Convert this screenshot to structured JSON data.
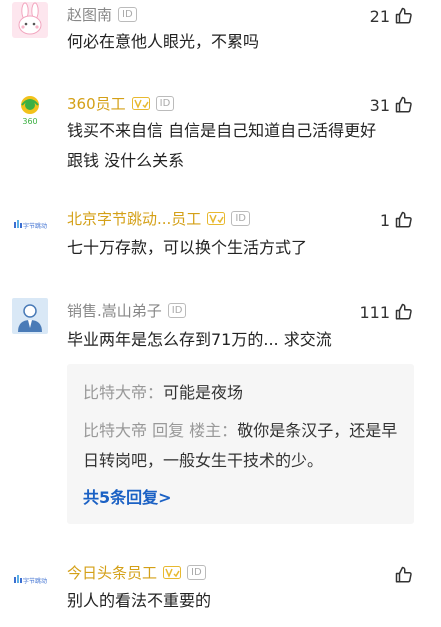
{
  "comments": [
    {
      "author": "赵图南",
      "id_badge": "ID",
      "likes": "21",
      "text": "何必在意他人眼光，不累吗",
      "avatar_icon": "rabbit-avatar-icon"
    },
    {
      "author": "360员工",
      "id_badge": "ID",
      "likes": "31",
      "text": "钱买不来自信 自信是自己知道自己活得更好 跟钱 没什么关系",
      "avatar_icon": "360-logo-icon",
      "avatar_text": "360"
    },
    {
      "author": "北京字节跳动...员工",
      "id_badge": "ID",
      "likes": "1",
      "text": "七十万存款，可以换个生活方式了",
      "avatar_icon": "bytedance-logo-icon",
      "avatar_text": "字节跳动"
    },
    {
      "author": "销售.嵩山弟子",
      "id_badge": "ID",
      "likes": "111",
      "text": "毕业两年是怎么存到71万的... 求交流",
      "avatar_icon": "person-avatar-icon",
      "replies": [
        {
          "author": "比特大帝：",
          "text": "可能是夜场"
        },
        {
          "author": "比特大帝 回复 楼主：",
          "text": "敬你是条汉子，还是早日转岗吧，一般女生干技术的少。"
        }
      ],
      "more_replies": "共5条回复>"
    },
    {
      "author": "今日头条员工",
      "id_badge": "ID",
      "likes": "",
      "text": "别人的看法不重要的",
      "avatar_icon": "bytedance-logo-icon",
      "avatar_text": "字节跳动"
    }
  ],
  "colors": {
    "name_gray": "#888888",
    "name_gold": "#d4a017",
    "link_blue": "#1b61c4",
    "reply_bg": "#f6f6f6",
    "verified_badge": "#e8b930"
  }
}
